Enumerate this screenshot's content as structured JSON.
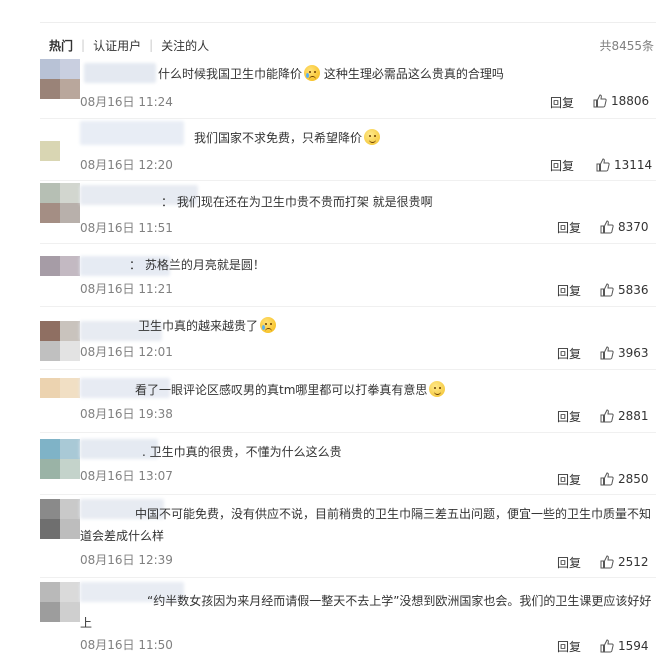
{
  "tabs": [
    {
      "label": "热门",
      "active": true
    },
    {
      "label": "认证用户",
      "active": false
    },
    {
      "label": "关注的人",
      "active": false
    }
  ],
  "total": "共8455条",
  "reply_label": "回复",
  "comments": [
    {
      "text": "什么时候我国卫生巾能降价",
      "text2": "这种生理必需品这么贵真的合理吗",
      "emoji": "sad",
      "date": "08月16日 11:24",
      "likes": "18806"
    },
    {
      "text": "我们国家不求免费，只希望降价",
      "emoji": "smile",
      "date": "08月16日 12:20",
      "likes": "13114"
    },
    {
      "text": "：  我们现在还在为卫生巾贵不贵而打架 就是很贵啊",
      "date": "08月16日 11:51",
      "likes": "8370"
    },
    {
      "text": "：  苏格兰的月亮就是圆！",
      "date": "08月16日 11:21",
      "likes": "5836"
    },
    {
      "text": "卫生巾真的越来越贵了",
      "emoji": "sad",
      "date": "08月16日 12:01",
      "likes": "3963"
    },
    {
      "text": "看了一眼评论区感叹男的真tm哪里都可以打拳真有意思",
      "emoji": "smile",
      "date": "08月16日 19:38",
      "likes": "2881"
    },
    {
      "text": ".  卫生巾真的很贵，不懂为什么这么贵",
      "date": "08月16日 13:07",
      "likes": "2850"
    },
    {
      "text": "中国不可能免费，没有供应不说，目前稍贵的卫生巾隔三差五出问题，便宜一些的卫生巾质量不知",
      "text2": "道会差成什么样",
      "date": "08月16日 12:39",
      "likes": "2512"
    },
    {
      "text": "“约半数女孩因为来月经而请假一整天不去上学”没想到欧洲国家也会。我们的卫生课更应该好好",
      "text2": "上",
      "date": "08月16日 11:50",
      "likes": "1594"
    }
  ],
  "icons": {
    "like": "thumbs-up-icon",
    "emoji_sad": "crying-face-icon",
    "emoji_smile": "smiling-face-icon"
  },
  "colors": {
    "text": "#333333",
    "muted": "#808080",
    "divider": "#eeeeee"
  }
}
